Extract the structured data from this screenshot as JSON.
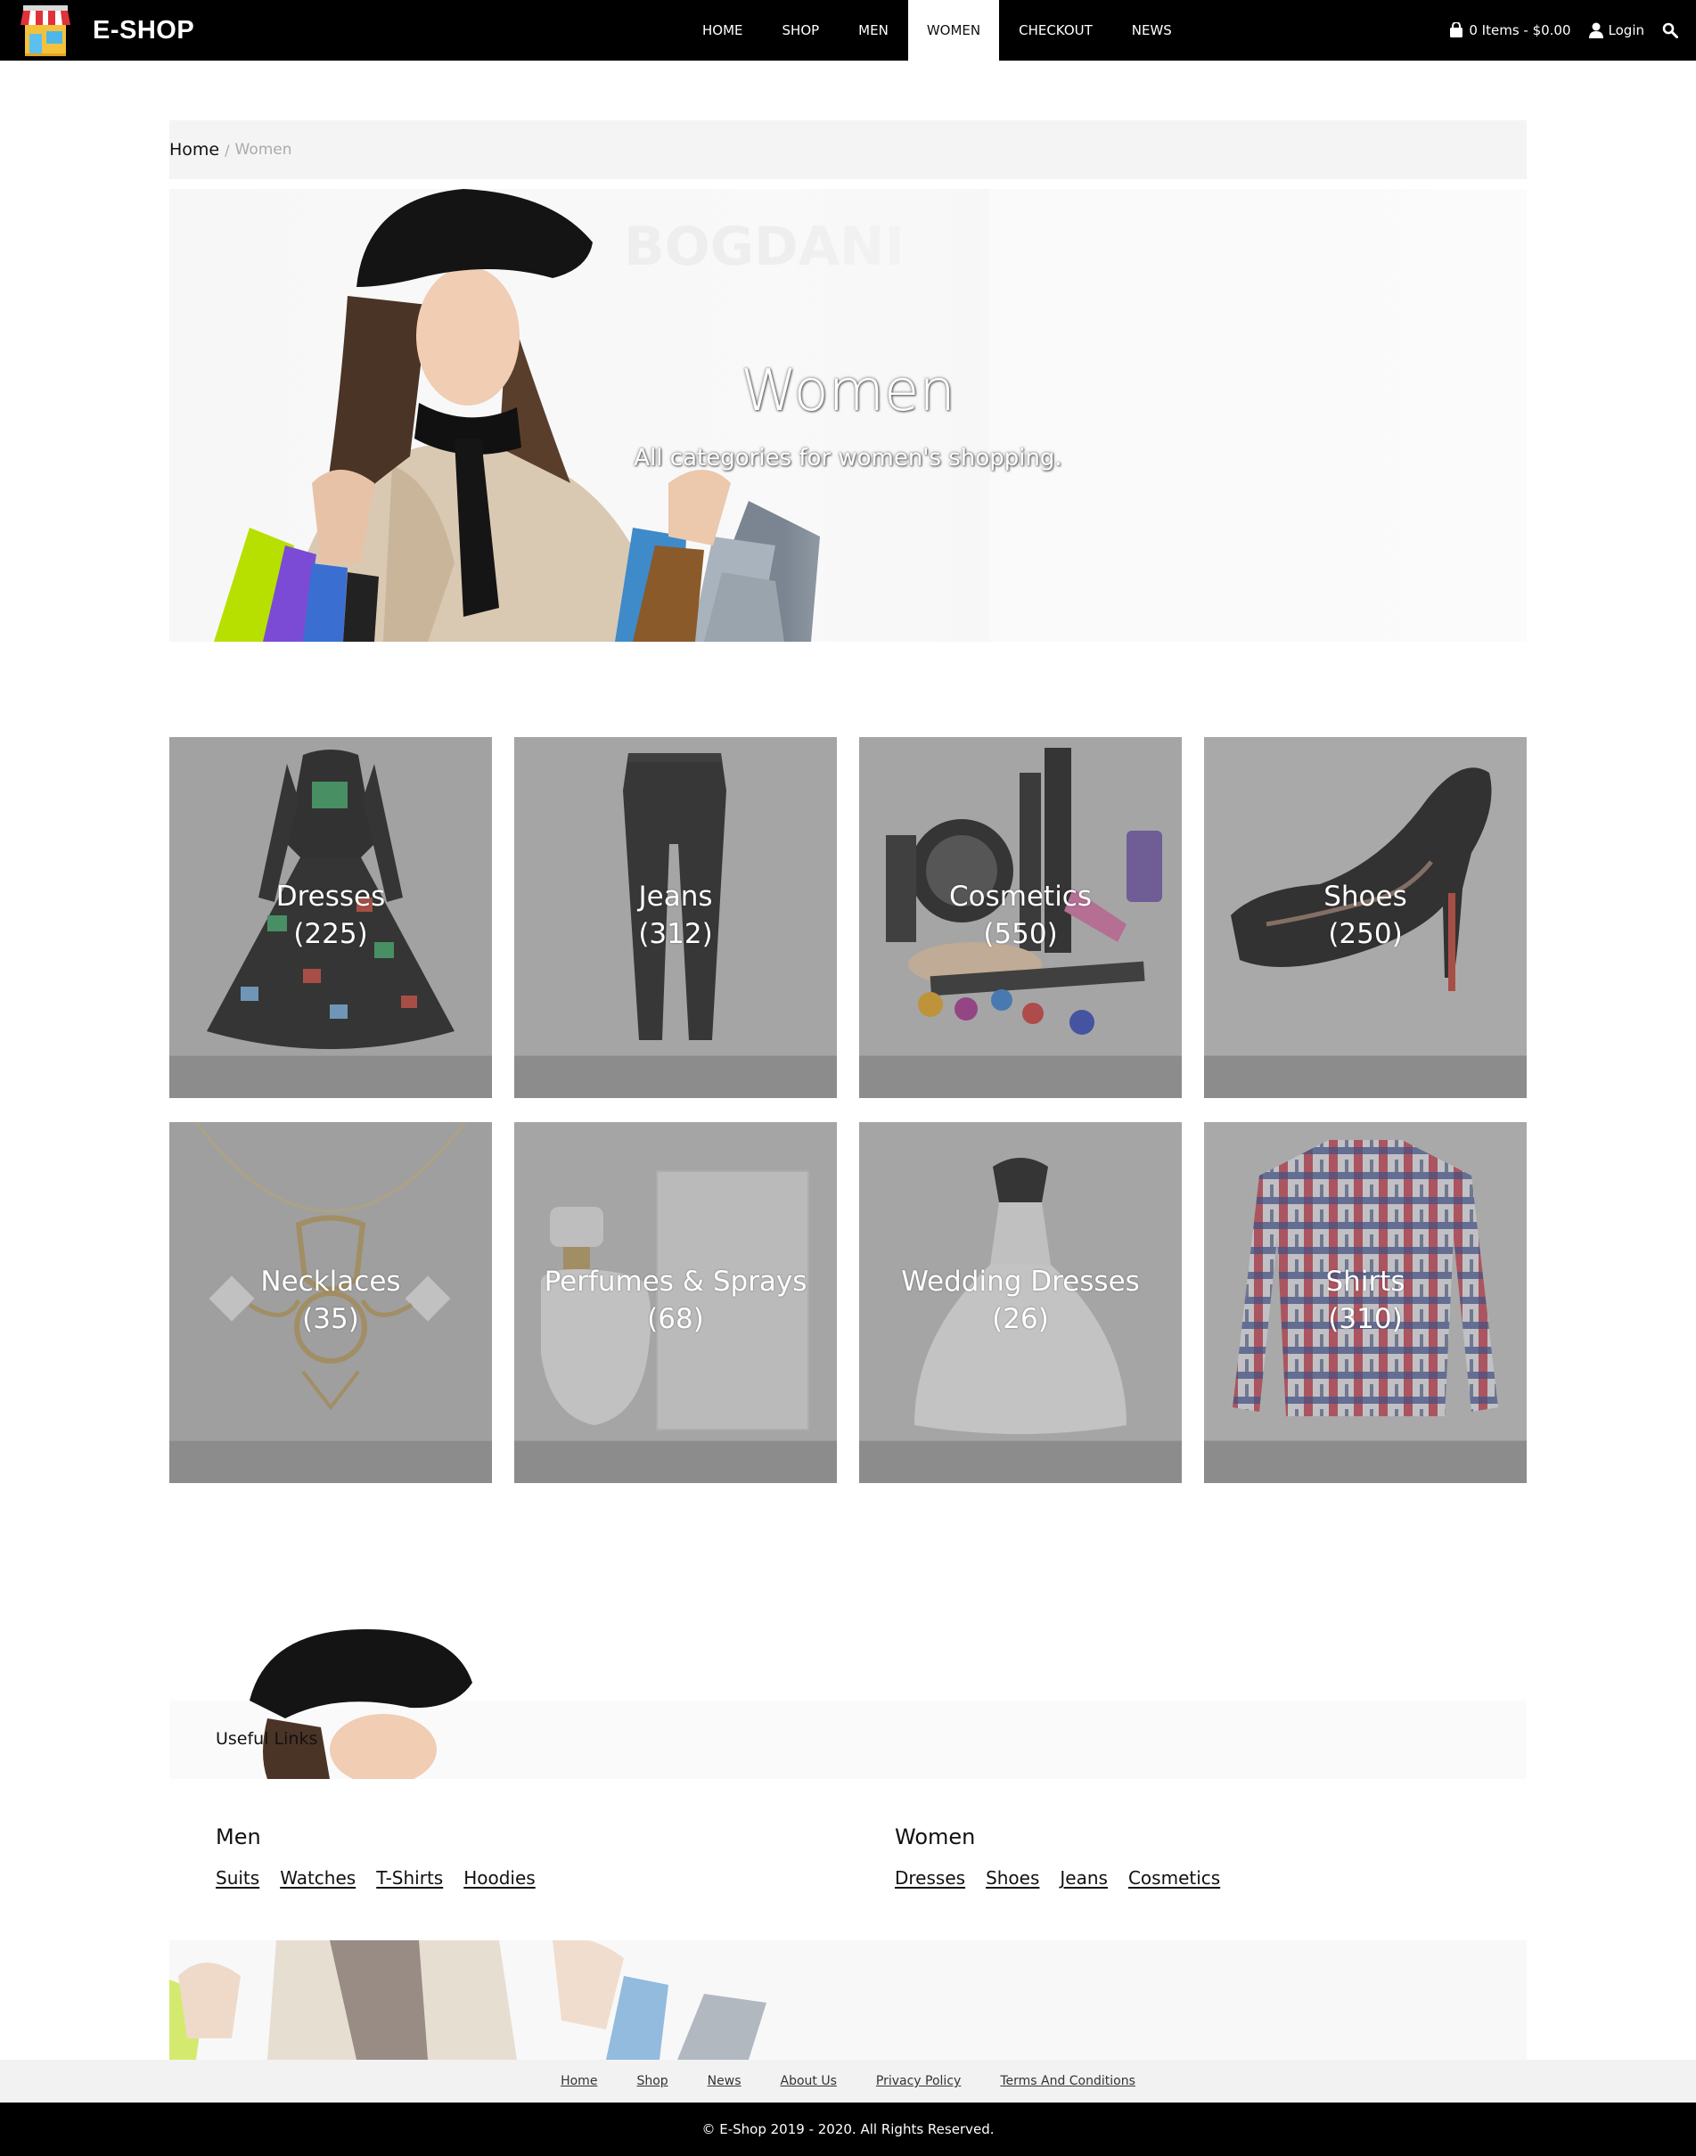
{
  "brand": {
    "name": "E-SHOP"
  },
  "nav": {
    "items": [
      {
        "label": "HOME",
        "active": false
      },
      {
        "label": "SHOP",
        "active": false
      },
      {
        "label": "MEN",
        "active": false
      },
      {
        "label": "WOMEN",
        "active": true
      },
      {
        "label": "CHECKOUT",
        "active": false
      },
      {
        "label": "NEWS",
        "active": false
      }
    ],
    "cart_label": "0 Items - $0.00",
    "login_label": "Login"
  },
  "breadcrumb": {
    "home": "Home",
    "separator": "/",
    "current": "Women"
  },
  "hero": {
    "title": "Women",
    "subtitle": "All categories for women's shopping."
  },
  "categories": [
    {
      "name": "Dresses",
      "count": "(225)",
      "icon": "dress-image"
    },
    {
      "name": "Jeans",
      "count": "(312)",
      "icon": "jeans-image"
    },
    {
      "name": "Cosmetics",
      "count": "(550)",
      "icon": "cosmetics-image"
    },
    {
      "name": "Shoes",
      "count": "(250)",
      "icon": "high-heels-image"
    },
    {
      "name": "Necklaces",
      "count": "(35)",
      "icon": "necklace-image"
    },
    {
      "name": "Perfumes & Sprays",
      "count": "(68)",
      "icon": "perfume-image"
    },
    {
      "name": "Wedding Dresses",
      "count": "(26)",
      "icon": "wedding-dress-image"
    },
    {
      "name": "Shirts",
      "count": "(310)",
      "icon": "plaid-shirt-image"
    }
  ],
  "footer": {
    "useful_links_title": "Useful Links",
    "men": {
      "title": "Men",
      "links": [
        "Suits",
        "Watches",
        "T-Shirts",
        "Hoodies"
      ]
    },
    "women": {
      "title": "Women",
      "links": [
        "Dresses",
        "Shoes",
        "Jeans",
        "Cosmetics"
      ]
    },
    "nav": [
      "Home",
      "Shop",
      "News",
      "About Us",
      "Privacy Policy",
      "Terms And Conditions"
    ],
    "copyright": "© E-Shop 2019 - 2020. All Rights Reserved."
  },
  "colors": {
    "navbar": "#000000",
    "tile_overlay": "#8f8f8f",
    "breadcrumb_bg": "#f4f4f4"
  }
}
